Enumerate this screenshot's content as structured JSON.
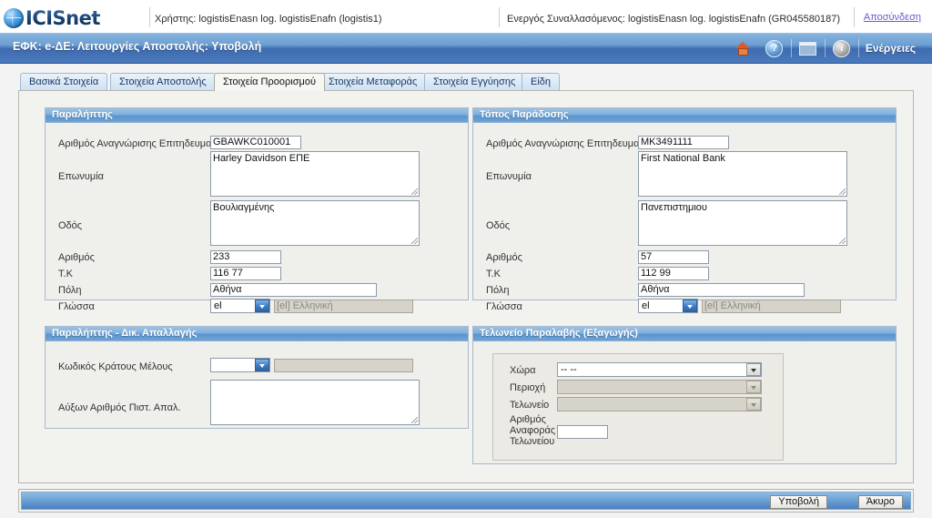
{
  "app": {
    "logo_text": "ICISnet",
    "user_label": "Χρήστης:",
    "user_value": "logistisEnasn log. logistisEnafn (logistis1)",
    "active_label": "Ενεργός Συναλλασόμενος:",
    "active_value": "logistisEnasn log. logistisEnafn (GR045580187)",
    "logout": "Αποσύνδεση",
    "title": "ΕΦΚ: e-ΔΕ: Λειτουργίες Αποστολής: Υποβολή",
    "actions": "Ενέργειες",
    "icons": {
      "home": "home-icon",
      "help": "?",
      "window": "window-icon",
      "info": "i"
    },
    "accent_blue": "#4a79bc",
    "panel_header_blue": "#6fa4d6"
  },
  "tabs": [
    {
      "label": "Βασικά Στοιχεία",
      "active": false
    },
    {
      "label": "Στοιχεία Αποστολής",
      "active": false
    },
    {
      "label": "Στοιχεία Προορισμού",
      "active": true
    },
    {
      "label": "Στοιχεία Μεταφοράς",
      "active": false
    },
    {
      "label": "Στοιχεία Εγγύησης",
      "active": false
    },
    {
      "label": "Είδη",
      "active": false
    }
  ],
  "panels": {
    "consignee": {
      "title": "Παραλήπτης",
      "fields": {
        "trader_id_label": "Αριθμός Αναγνώρισης Επιτηδευματία",
        "trader_id_value": "GBAWKC010001",
        "name_label": "Επωνυμία",
        "name_value": "Harley Davidson ΕΠΕ",
        "street_label": "Οδός",
        "street_value": "Βουλιαγμένης",
        "number_label": "Αριθμός",
        "number_value": "233",
        "postcode_label": "Τ.Κ",
        "postcode_value": "116 77",
        "city_label": "Πόλη",
        "city_value": "Αθήνα",
        "language_label": "Γλώσσα",
        "language_code": "el",
        "language_desc": "[el] Ελληνική"
      }
    },
    "delivery_place": {
      "title": "Τόπος Παράδοσης",
      "fields": {
        "trader_id_label": "Αριθμός Αναγνώρισης Επιτηδευματία",
        "trader_id_value": "MK3491111",
        "name_label": "Επωνυμία",
        "name_value": "First National Bank",
        "street_label": "Οδός",
        "street_value": "Πανεπιστημιου",
        "number_label": "Αριθμός",
        "number_value": "57",
        "postcode_label": "Τ.Κ",
        "postcode_value": "112 99",
        "city_label": "Πόλη",
        "city_value": "Αθήνα",
        "language_label": "Γλώσσα",
        "language_code": "el",
        "language_desc": "[el] Ελληνική"
      }
    },
    "exemption": {
      "title": "Παραλήπτης - Δικ. Απαλλαγής",
      "fields": {
        "member_state_label": "Κωδικός Κράτους Μέλους",
        "member_state_code": "",
        "member_state_desc": "",
        "certificate_label": "Αύξων Αριθμός Πιστ. Απαλ.",
        "certificate_value": ""
      }
    },
    "customs_office": {
      "title": "Τελωνείο Παραλαβής (Εξαγωγής)",
      "fields": {
        "country_label": "Χώρα",
        "country_value": "-- --",
        "region_label": "Περιοχή",
        "region_value": "",
        "office_label": "Τελωνείο",
        "office_value": "",
        "reference_label": "Αριθμός Αναφοράς Τελωνείου",
        "reference_label_lines": [
          "Αριθμός",
          "Αναφοράς",
          "Τελωνείου"
        ],
        "reference_value": ""
      }
    }
  },
  "footer": {
    "submit": "Υποβολή",
    "cancel": "Άκυρο"
  }
}
